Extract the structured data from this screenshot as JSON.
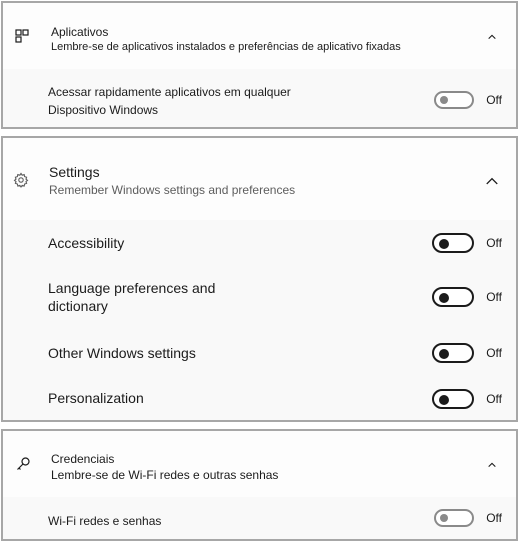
{
  "apps": {
    "icon": "apps-grid-icon",
    "title": "Aplicativos",
    "subtitle": "Lembre-se de aplicativos instalados e preferências de aplicativo fixadas",
    "rows": [
      {
        "label_line1": "Acessar rapidamente aplicativos em qualquer",
        "label_line2": "Dispositivo Windows",
        "state": "Off",
        "on": false
      }
    ]
  },
  "settings": {
    "icon": "gear-icon",
    "title": "Settings",
    "subtitle": "Remember Windows settings and preferences",
    "rows": [
      {
        "label": "Accessibility",
        "state": "Off",
        "on": false
      },
      {
        "label_line1": "Language preferences and",
        "label_line2": "dictionary",
        "state": "Off",
        "on": false
      },
      {
        "label": "Other Windows settings",
        "state": "Off",
        "on": false
      },
      {
        "label": "Personalization",
        "state": "Off",
        "on": false
      }
    ]
  },
  "credentials": {
    "icon": "key-icon",
    "title": "Credenciais",
    "subtitle": "Lembre-se de Wi-Fi redes e outras senhas",
    "rows": [
      {
        "label": "Wi-Fi redes e senhas",
        "state": "Off",
        "on": false
      }
    ]
  },
  "colors": {
    "border": "#a7a7a7",
    "text": "#1b1b1b",
    "subtext": "#5d5d5d",
    "toggle_off_dim": "#8a8a8a"
  }
}
